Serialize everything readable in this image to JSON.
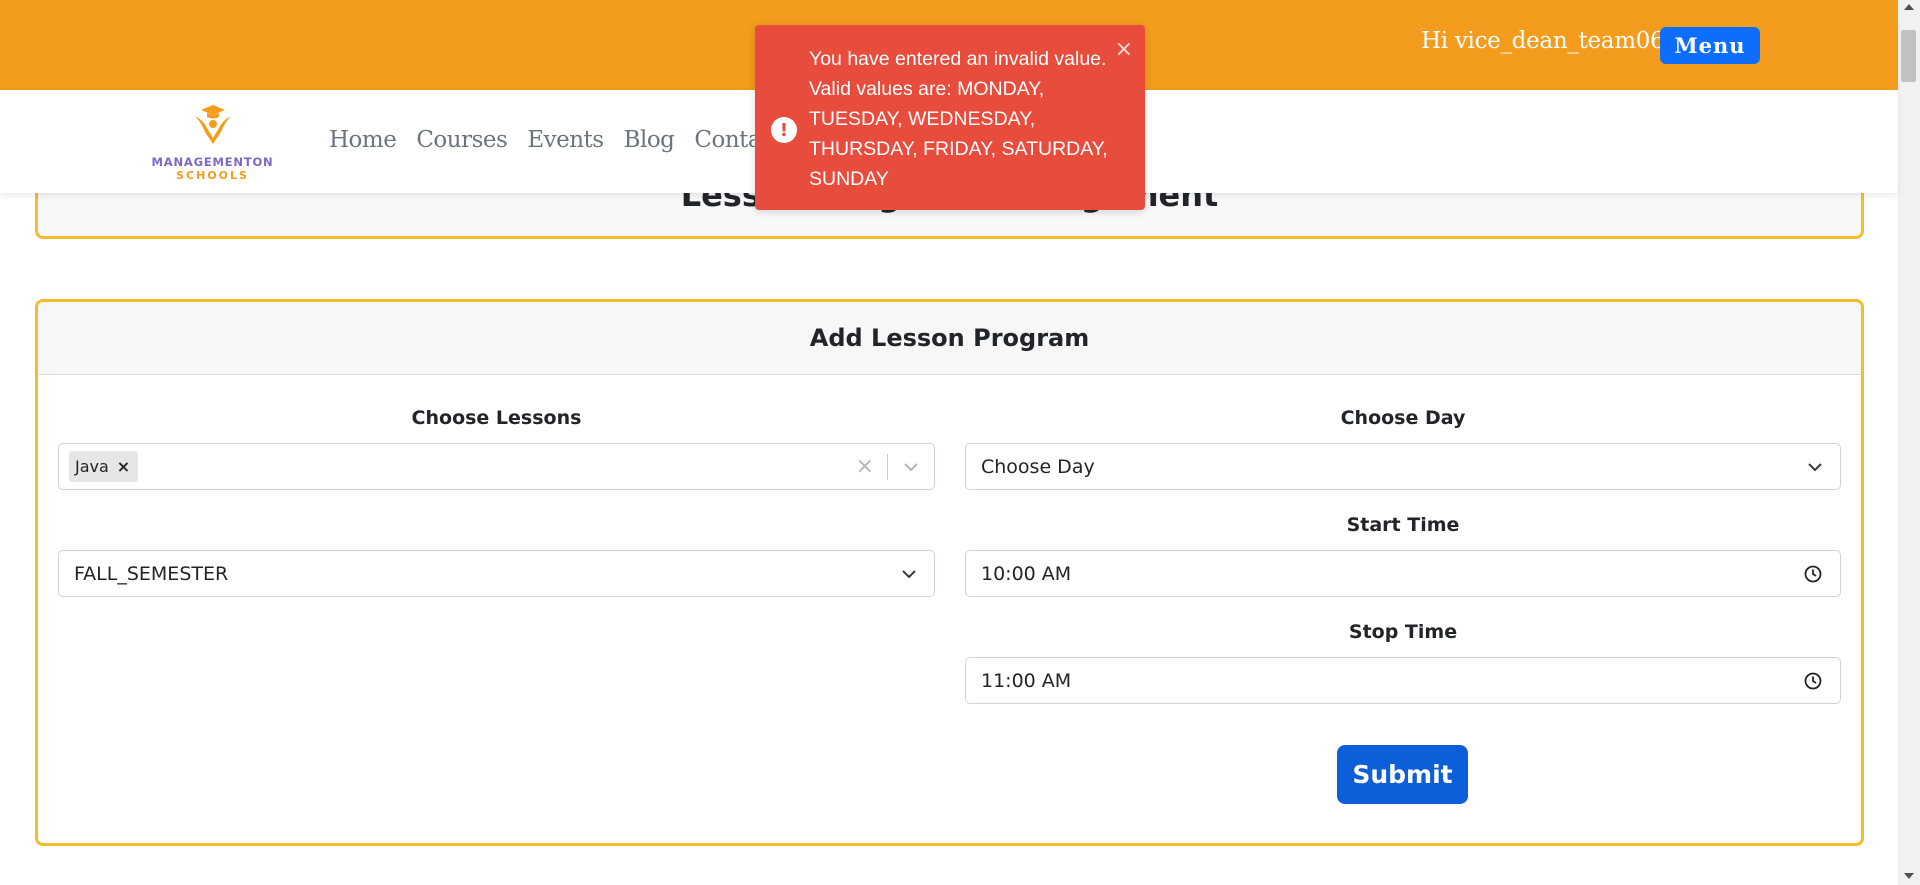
{
  "header": {
    "greeting": "Hi vice_dean_team06",
    "menu_label": "Menu"
  },
  "logo": {
    "line1": "MANAGEMENTON",
    "line2": "SCHOOLS",
    "brand_purple": "#7b68c9",
    "brand_orange": "#f39c1d"
  },
  "nav": {
    "items": [
      "Home",
      "Courses",
      "Events",
      "Blog",
      "Contact"
    ]
  },
  "page": {
    "title": "Lesson Program Management"
  },
  "form": {
    "heading": "Add Lesson Program",
    "lessons_label": "Choose Lessons",
    "lessons_selected": [
      "Java"
    ],
    "chip_remove": "×",
    "clear_icon": "×",
    "semester_value": "FALL_SEMESTER",
    "day_label": "Choose Day",
    "day_value": "Choose Day",
    "start_label": "Start Time",
    "start_value": "10:00  AM",
    "stop_label": "Stop Time",
    "stop_value": "11:00  AM",
    "submit_label": "Submit"
  },
  "toast": {
    "icon": "!",
    "message": "You have entered an invalid value. Valid values are: MONDAY, TUESDAY, WEDNESDAY, THURSDAY, FRIDAY, SATURDAY, SUNDAY",
    "close": "×",
    "color": "#e74c3c"
  },
  "colors": {
    "topbar": "#f39c1d",
    "card_border": "#f8bb2d",
    "primary": "#0d6efd"
  }
}
